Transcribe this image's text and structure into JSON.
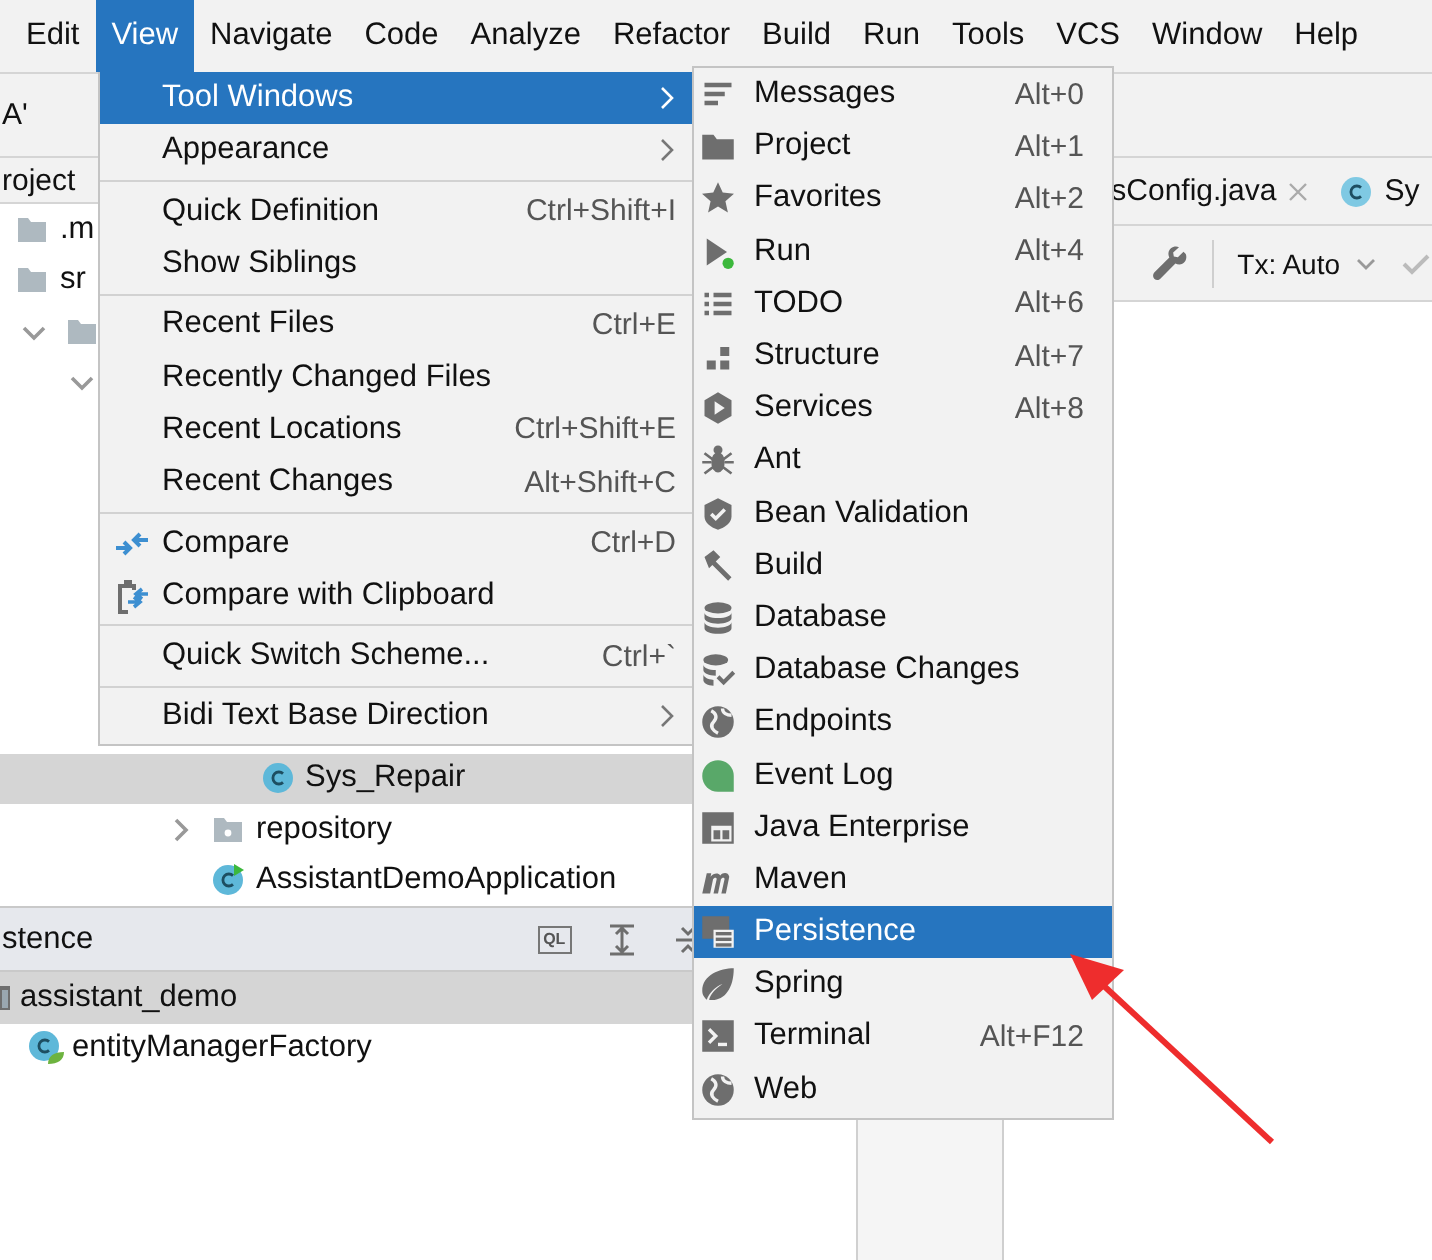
{
  "menu_bar": [
    {
      "label": "Edit",
      "selected": false
    },
    {
      "label": "View",
      "selected": true
    },
    {
      "label": "Navigate",
      "selected": false
    },
    {
      "label": "Code",
      "selected": false
    },
    {
      "label": "Analyze",
      "selected": false
    },
    {
      "label": "Refactor",
      "selected": false
    },
    {
      "label": "Build",
      "selected": false
    },
    {
      "label": "Run",
      "selected": false
    },
    {
      "label": "Tools",
      "selected": false
    },
    {
      "label": "VCS",
      "selected": false
    },
    {
      "label": "Window",
      "selected": false
    },
    {
      "label": "Help",
      "selected": false
    }
  ],
  "navigation_bar": {
    "text": "A'"
  },
  "project_panel": {
    "title": "roject",
    "tree": [
      {
        "kind": "folder",
        "label": ".m"
      },
      {
        "kind": "folder",
        "label": "sr",
        "children": [
          {
            "kind": "folder",
            "expanded": true,
            "children": [
              {
                "expanded": true,
                "children": [
                  {
                    "children": [
                      {
                        "children": [
                          {
                            "kind": "class",
                            "label": "Sys_Repair",
                            "selected": true
                          }
                        ]
                      },
                      {
                        "kind": "package",
                        "label": "repository",
                        "expanded": false,
                        "selected": false
                      },
                      {
                        "kind": "app_class",
                        "label": "AssistantDemoApplication",
                        "selected": false
                      }
                    ]
                  }
                ]
              }
            ]
          }
        ]
      }
    ]
  },
  "persistence_panel": {
    "title": "stence",
    "ql_label": "QL",
    "tree": [
      {
        "kind": "module",
        "label": "assistant_demo",
        "selected": true,
        "children": [
          {
            "kind": "bean",
            "label": "entityManagerFactory",
            "selected": false
          }
        ]
      }
    ]
  },
  "editor": {
    "tabs": [
      {
        "label": "sConfig.java",
        "closable": true
      },
      {
        "label": "Sy",
        "closable": false
      }
    ],
    "tx_label": "Tx: Auto"
  },
  "view_menu": {
    "groups": [
      [
        {
          "label": "Tool Windows",
          "has_submenu": true,
          "selected": true
        },
        {
          "label": "Appearance",
          "has_submenu": true,
          "selected": false
        }
      ],
      [
        {
          "label": "Quick Definition",
          "shortcut": "Ctrl+Shift+I",
          "has_submenu": false,
          "selected": false
        },
        {
          "label": "Show Siblings",
          "has_submenu": false,
          "selected": false
        }
      ],
      [
        {
          "label": "Recent Files",
          "shortcut": "Ctrl+E",
          "has_submenu": false,
          "selected": false
        },
        {
          "label": "Recently Changed Files",
          "has_submenu": false,
          "selected": false
        },
        {
          "label": "Recent Locations",
          "shortcut": "Ctrl+Shift+E",
          "has_submenu": false,
          "selected": false
        },
        {
          "label": "Recent Changes",
          "shortcut": "Alt+Shift+C",
          "has_submenu": false,
          "selected": false
        }
      ],
      [
        {
          "label": "Compare",
          "shortcut": "Ctrl+D",
          "has_submenu": false,
          "selected": false,
          "kind": "compare"
        },
        {
          "label": "Compare with Clipboard",
          "has_submenu": false,
          "selected": false,
          "kind": "clipboard"
        }
      ],
      [
        {
          "label": "Quick Switch Scheme...",
          "shortcut": "Ctrl+`",
          "has_submenu": false,
          "selected": false
        }
      ],
      [
        {
          "label": "Bidi Text Base Direction",
          "has_submenu": true,
          "selected": false
        }
      ]
    ]
  },
  "tool_windows_menu": {
    "items": [
      {
        "label": "Messages",
        "shortcut": "Alt+0",
        "selected": false
      },
      {
        "label": "Project",
        "shortcut": "Alt+1",
        "selected": false
      },
      {
        "label": "Favorites",
        "shortcut": "Alt+2",
        "selected": false
      },
      {
        "label": "Run",
        "shortcut": "Alt+4",
        "selected": false
      },
      {
        "label": "TODO",
        "shortcut": "Alt+6",
        "selected": false
      },
      {
        "label": "Structure",
        "shortcut": "Alt+7",
        "selected": false
      },
      {
        "label": "Services",
        "shortcut": "Alt+8",
        "selected": false
      },
      {
        "label": "Ant",
        "selected": false
      },
      {
        "label": "Bean Validation",
        "selected": false
      },
      {
        "label": "Build",
        "selected": false
      },
      {
        "label": "Database",
        "selected": false
      },
      {
        "label": "Database Changes",
        "selected": false
      },
      {
        "label": "Endpoints",
        "selected": false
      },
      {
        "label": "Event Log",
        "selected": false
      },
      {
        "label": "Java Enterprise",
        "selected": false
      },
      {
        "label": "Maven",
        "selected": false
      },
      {
        "label": "Persistence",
        "selected": true
      },
      {
        "label": "Spring",
        "selected": false
      },
      {
        "label": "Terminal",
        "shortcut": "Alt+F12",
        "selected": false
      },
      {
        "label": "Web",
        "selected": false
      }
    ]
  }
}
